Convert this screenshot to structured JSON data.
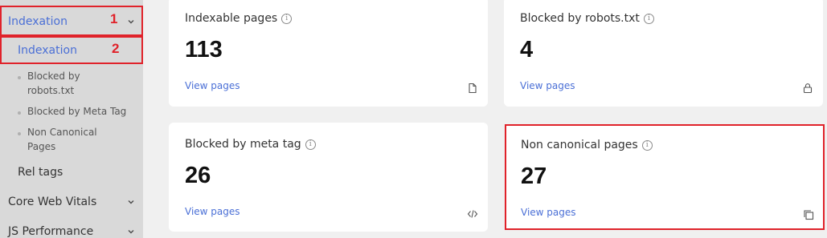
{
  "sidebar": {
    "indexation_label": "Indexation",
    "indexation_badge": "1",
    "sub_label": "Indexation",
    "sub_badge": "2",
    "leaf_blocked_robots": "Blocked by robots.txt",
    "leaf_blocked_meta": "Blocked by Meta Tag",
    "leaf_non_canonical": "Non Canonical Pages",
    "rel_tags": "Rel tags",
    "core_web_vitals": "Core Web Vitals",
    "js_performance": "JS Performance"
  },
  "cards": {
    "indexable": {
      "title": "Indexable pages",
      "value": "113",
      "link": "View pages",
      "icon": "file-icon"
    },
    "robots": {
      "title": "Blocked by robots.txt",
      "value": "4",
      "link": "View pages",
      "icon": "lock-icon"
    },
    "meta": {
      "title": "Blocked by meta tag",
      "value": "26",
      "link": "View pages",
      "icon": "code-icon"
    },
    "canonical": {
      "title": "Non canonical pages",
      "value": "27",
      "link": "View pages",
      "icon": "copy-icon"
    }
  },
  "colors": {
    "accent": "#4a6fd6",
    "highlight": "#e0222a",
    "sidebar_bg": "#d9d9d9",
    "page_bg": "#f0f0f0"
  }
}
